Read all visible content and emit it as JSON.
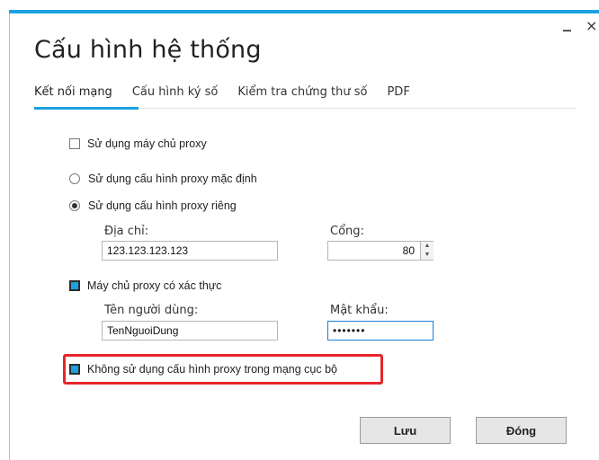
{
  "window": {
    "title": "Cấu hình hệ thống",
    "minimize_glyph": "_",
    "close_glyph": "×",
    "accent_color": "#1ba1e2"
  },
  "tabs": [
    {
      "label": "Kết nối mạng",
      "active": true
    },
    {
      "label": "Cấu hình ký số",
      "active": false
    },
    {
      "label": "Kiểm tra chứng thư số",
      "active": false
    },
    {
      "label": "PDF",
      "active": false
    }
  ],
  "proxy": {
    "use_proxy_label": "Sử dụng máy chủ proxy",
    "use_proxy_checked": false,
    "default_config_label": "Sử dụng cấu hình proxy mặc định",
    "custom_config_label": "Sử dụng cấu hình proxy riêng",
    "selected_option": "custom",
    "address_label": "Địa chỉ:",
    "address_value": "123.123.123.123",
    "port_label": "Cổng:",
    "port_value": "80",
    "auth_label": "Máy chủ proxy có xác thực",
    "auth_checked": true,
    "username_label": "Tên người dùng:",
    "username_value": "TenNguoiDung",
    "password_label": "Mật khẩu:",
    "password_value": "•••••••",
    "bypass_local_label": "Không sử dụng cấu hình proxy trong mạng cục bộ",
    "bypass_local_checked": true
  },
  "buttons": {
    "save_label": "Lưu",
    "close_label": "Đóng"
  }
}
